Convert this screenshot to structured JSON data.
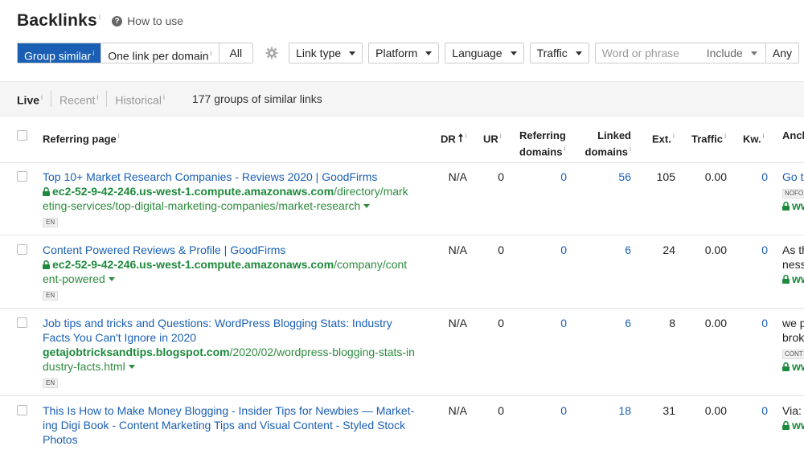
{
  "header": {
    "title": "Backlinks",
    "title_info": "i",
    "help": "How to use"
  },
  "toolbar": {
    "group_similar": "Group similar",
    "one_link": "One link per domain",
    "all": "All",
    "info": "i",
    "link_type": "Link type",
    "platform": "Platform",
    "language": "Language",
    "traffic": "Traffic",
    "search_placeholder": "Word or phrase",
    "include": "Include",
    "any": "Any"
  },
  "subbar": {
    "live": "Live",
    "recent": "Recent",
    "historical": "Historical",
    "info": "i",
    "count": "177 groups of similar links"
  },
  "columns": {
    "referring_page": "Referring page",
    "dr": "DR",
    "ur": "UR",
    "referring_domains_1": "Referring",
    "referring_domains_2": "domains",
    "linked_domains_1": "Linked",
    "linked_domains_2": "domains",
    "ext": "Ext.",
    "traffic": "Traffic",
    "kw": "Kw.",
    "anchor": "Anch",
    "info": "i"
  },
  "rows": [
    {
      "title": "Top 10+ Market Research Companies - Reviews 2020 | GoodFirms",
      "domain": "ec2-52-9-42-246.us-west-1.compute.amazonaws.com",
      "path1": "/directory/mark",
      "path2": "eting-services/top-digital-marketing-companies/market-research",
      "lang": "EN",
      "dr": "N/A",
      "ur": "0",
      "ref_domains": "0",
      "linked_domains": "56",
      "ext": "105",
      "traffic": "0.00",
      "kw": "0",
      "anchor1": "Go t",
      "anchor2": "NOFO",
      "anchor3": "ww"
    },
    {
      "title": "Content Powered Reviews & Profile | GoodFirms",
      "domain": "ec2-52-9-42-246.us-west-1.compute.amazonaws.com",
      "path1": "/company/cont",
      "path2": "ent-powered",
      "lang": "EN",
      "dr": "N/A",
      "ur": "0",
      "ref_domains": "0",
      "linked_domains": "6",
      "ext": "24",
      "traffic": "0.00",
      "kw": "0",
      "anchor1": "As th",
      "anchor2": "ness",
      "anchor3": "ww"
    },
    {
      "title1": "Job tips and tricks and Questions: WordPress Blogging Stats: Industry",
      "title2": "Facts You Can't Ignore in 2020",
      "domain": "getajobtricksandtips.blogspot.com",
      "path1": "/2020/02/wordpress-blogging-stats-in",
      "path2": "dustry-facts.html",
      "lang": "EN",
      "dr": "N/A",
      "ur": "0",
      "ref_domains": "0",
      "linked_domains": "6",
      "ext": "8",
      "traffic": "0.00",
      "kw": "0",
      "anchor1": "we p",
      "anchor2": "brok",
      "anchor3": "CONT",
      "anchor4": "ww"
    },
    {
      "title1": "This Is How to Make Money Blogging - Insider Tips for Newbies — Market-",
      "title2": "ing Digi Book - Content Marketing Tips and Visual Content - Styled Stock",
      "title3": "Photos",
      "dr": "N/A",
      "ur": "0",
      "ref_domains": "0",
      "linked_domains": "18",
      "ext": "31",
      "traffic": "0.00",
      "kw": "0",
      "anchor1": "Via:",
      "anchor2": "ww"
    }
  ]
}
